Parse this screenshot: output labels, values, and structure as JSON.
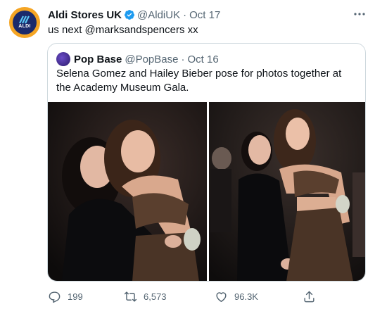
{
  "tweet": {
    "author_name": "Aldi Stores UK",
    "author_handle": "@AldiUK",
    "separator": "·",
    "date": "Oct 17",
    "text": "us next @marksandspencers xx",
    "avatar_text": "ALDI"
  },
  "quoted": {
    "author_name": "Pop Base",
    "author_handle": "@PopBase",
    "separator": "·",
    "date": "Oct 16",
    "text": "Selena Gomez and Hailey Bieber pose for photos together at the Academy Museum Gala."
  },
  "actions": {
    "reply_count": "199",
    "retweet_count": "6,573",
    "like_count": "96.3K"
  },
  "icons": [
    "verified-badge-icon",
    "more-icon",
    "reply-icon",
    "retweet-icon",
    "like-icon",
    "share-icon"
  ],
  "colors": {
    "verified": "#1d9bf0",
    "secondary_text": "#536471",
    "border": "#cfd9de",
    "aldi_orange": "#f5a524",
    "aldi_blue": "#1b2a6b"
  }
}
